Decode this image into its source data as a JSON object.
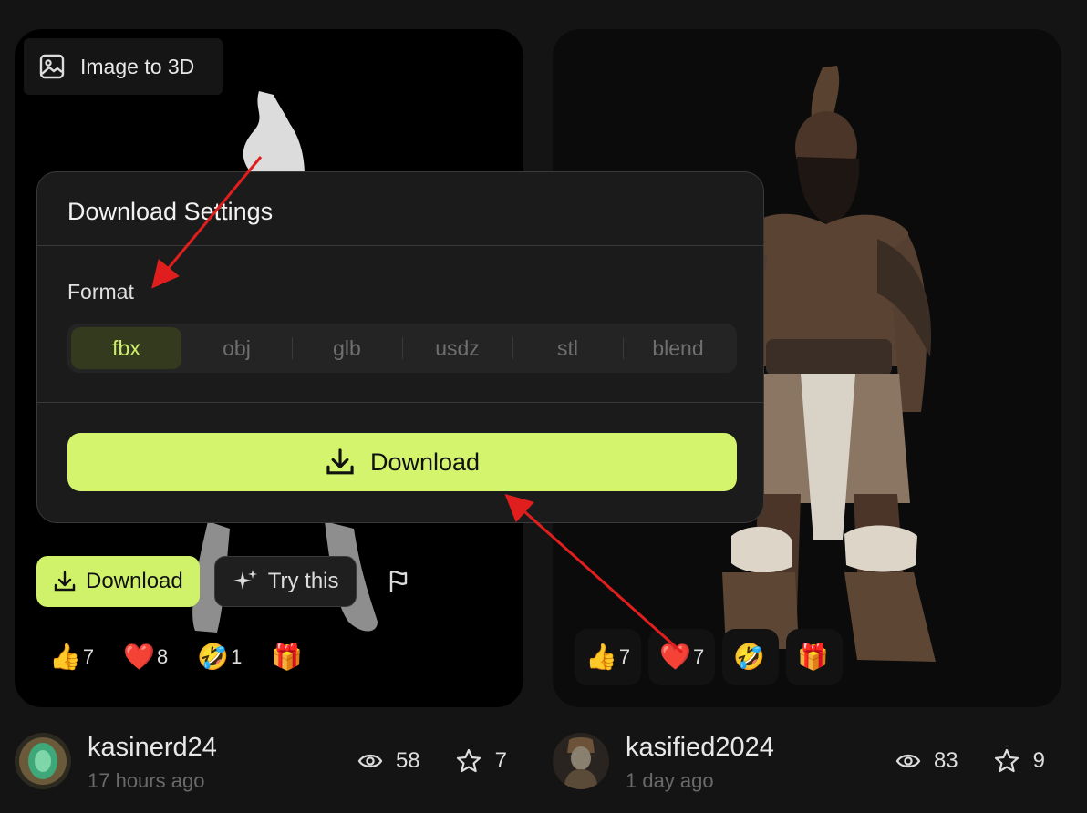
{
  "left_card": {
    "badge_label": "Image to 3D",
    "download_label": "Download",
    "try_label": "Try this",
    "reactions": [
      {
        "emoji": "👍",
        "count": "7"
      },
      {
        "emoji": "❤️",
        "count": "8"
      },
      {
        "emoji": "🤣",
        "count": "1"
      },
      {
        "emoji": "🎁",
        "count": ""
      }
    ],
    "user": "kasinerd24",
    "time": "17 hours ago",
    "views": "58",
    "stars": "7"
  },
  "right_card": {
    "reactions": [
      {
        "emoji": "👍",
        "count": "7"
      },
      {
        "emoji": "❤️",
        "count": "7"
      },
      {
        "emoji": "🤣",
        "count": ""
      },
      {
        "emoji": "🎁",
        "count": ""
      }
    ],
    "user": "kasified2024",
    "time": "1 day ago",
    "views": "83",
    "stars": "9"
  },
  "popup": {
    "title": "Download Settings",
    "format_label": "Format",
    "formats": [
      "fbx",
      "obj",
      "glb",
      "usdz",
      "stl",
      "blend"
    ],
    "selected_format": "fbx",
    "download_label": "Download"
  },
  "colors": {
    "accent": "#cff26a",
    "annotation_arrow": "#e01e1e"
  }
}
